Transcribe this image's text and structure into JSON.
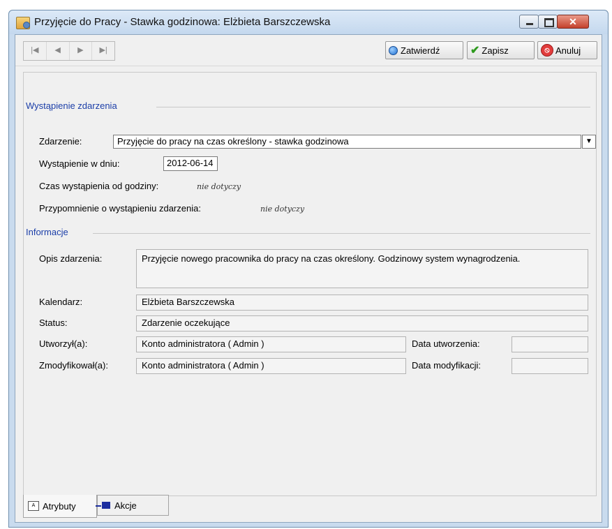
{
  "window": {
    "title": "Przyjęcie do Pracy - Stawka godzinowa:  Elżbieta Barszczewska"
  },
  "toolbar": {
    "nav": [
      "|◀",
      "◀",
      "▶",
      "▶|"
    ],
    "confirm_label": "Zatwierdź",
    "save_label": "Zapisz",
    "cancel_label": "Anuluj"
  },
  "event_section": {
    "title": "Wystąpienie zdarzenia",
    "event_label": "Zdarzenie:",
    "event_value": "Przyjęcie do pracy na czas określony - stawka godzinowa",
    "date_label": "Wystąpienie w dniu:",
    "date_value": "2012-06-14",
    "time_label": "Czas wystąpienia od godziny:",
    "time_value": "nie dotyczy",
    "reminder_label": "Przypomnienie o wystąpieniu zdarzenia:",
    "reminder_value": "nie dotyczy"
  },
  "info_section": {
    "title": "Informacje",
    "description_label": "Opis zdarzenia:",
    "description_value": "Przyjęcie nowego pracownika do pracy na czas określony. Godzinowy system wynagrodzenia.",
    "calendar_label": "Kalendarz:",
    "calendar_value": "Elżbieta Barszczewska",
    "status_label": "Status:",
    "status_value": "Zdarzenie oczekujące",
    "created_by_label": "Utworzył(a):",
    "created_by_value": "Konto administratora ( Admin )",
    "created_date_label": "Data utworzenia:",
    "created_date_value": "",
    "modified_by_label": "Zmodyfikował(a):",
    "modified_by_value": "Konto administratora ( Admin )",
    "modified_date_label": "Data modyfikacji:",
    "modified_date_value": ""
  },
  "tabs": [
    {
      "label": "Atrybuty",
      "active": true
    },
    {
      "label": "Akcje",
      "active": false
    }
  ]
}
